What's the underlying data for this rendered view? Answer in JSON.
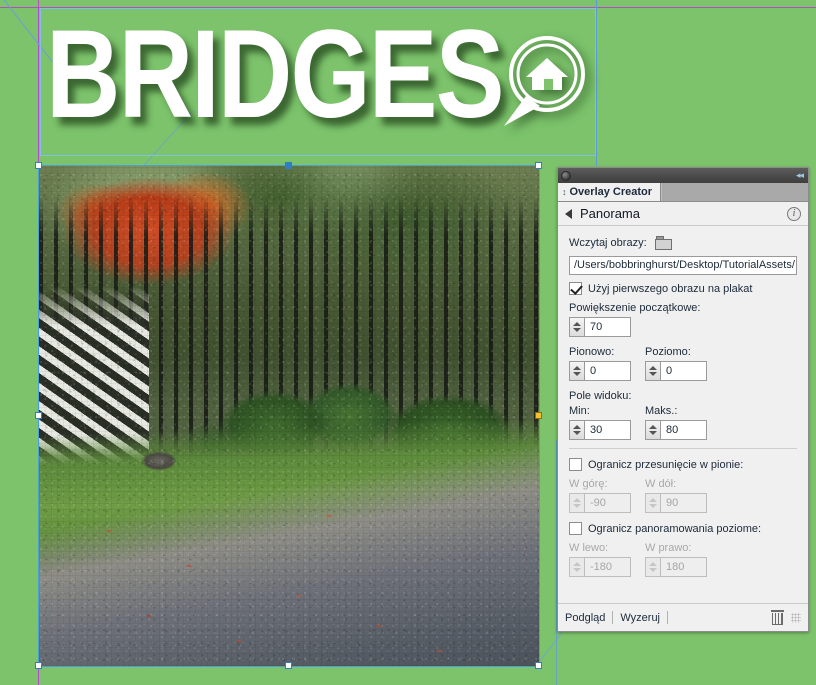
{
  "document": {
    "headline": "BRIDGES",
    "logo_icon": "house-speech-bubble-icon",
    "canvas_color": "#7cc36b",
    "guide_color": "#b44cc4",
    "frame_color": "#4a9fd4"
  },
  "panel": {
    "titlebar": {
      "menu_icon": "panel-menu-dot-icon",
      "collapse_icon": "collapse-double-arrow-icon"
    },
    "tab": {
      "label": "Overlay Creator",
      "grip_icon": "drag-grip-icon"
    },
    "subheader": {
      "back_icon": "back-arrow-icon",
      "title": "Panorama",
      "info_icon": "info-icon"
    },
    "load": {
      "label": "Wczytaj obrazy:",
      "folder_icon": "folder-icon",
      "path_value": "/Users/bobbringhurst/Desktop/TutorialAssets/",
      "path_placeholder": "/Users/"
    },
    "use_first_image": {
      "label": "Użyj pierwszego obrazu na plakat",
      "checked": true
    },
    "initial_zoom": {
      "label": "Powiększenie początkowe:",
      "value": "70"
    },
    "vertical": {
      "label": "Pionowo:",
      "value": "0"
    },
    "horizontal": {
      "label": "Poziomo:",
      "value": "0"
    },
    "field_of_view": {
      "label": "Pole widoku:",
      "min_label": "Min:",
      "min_value": "30",
      "max_label": "Maks.:",
      "max_value": "80"
    },
    "limit_vertical": {
      "label": "Ogranicz przesunięcie w pionie:",
      "checked": false,
      "up_label": "W górę:",
      "up_value": "-90",
      "down_label": "W dół:",
      "down_value": "90"
    },
    "limit_horizontal": {
      "label": "Ogranicz panoramowania poziome:",
      "checked": false,
      "left_label": "W lewo:",
      "left_value": "-180",
      "right_label": "W prawo:",
      "right_value": "180"
    },
    "footer": {
      "preview_label": "Podgląd",
      "reset_label": "Wyzeruj",
      "trash_icon": "trash-icon",
      "resize_grip_icon": "resize-grip-icon"
    }
  }
}
